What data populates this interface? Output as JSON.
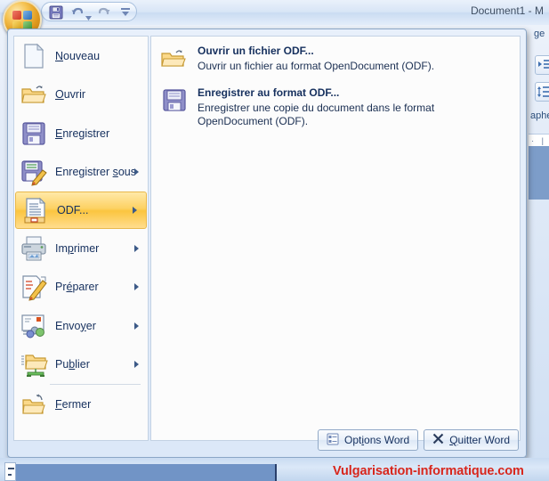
{
  "window": {
    "title": "Document1 - M",
    "office_button": "office-orb"
  },
  "quick_access_toolbar": {
    "buttons": [
      {
        "name": "save-icon",
        "label": "Enregistrer"
      },
      {
        "name": "undo-icon",
        "label": "Annuler"
      },
      {
        "name": "redo-icon",
        "label": "Rétablir"
      },
      {
        "name": "customize-icon",
        "label": "Personnaliser la barre d'outils Accès rapide"
      }
    ]
  },
  "ribbon_fragment": {
    "tab_label": "ge",
    "group_label": "aphe",
    "ruler_ticks": "· | ·"
  },
  "file_menu": {
    "items": [
      {
        "label_pre": "",
        "label_accel": "N",
        "label_post": "ouveau",
        "icon": "new-document-icon",
        "has_submenu": false,
        "selected": false
      },
      {
        "label_pre": "",
        "label_accel": "O",
        "label_post": "uvrir",
        "icon": "open-folder-icon",
        "has_submenu": false,
        "selected": false
      },
      {
        "label_pre": "",
        "label_accel": "E",
        "label_post": "nregistrer",
        "icon": "save-floppy-icon",
        "has_submenu": false,
        "selected": false
      },
      {
        "label_pre": "Enregistrer ",
        "label_accel": "s",
        "label_post": "ous",
        "icon": "save-as-icon",
        "has_submenu": true,
        "selected": false
      },
      {
        "label_pre": "ODF...",
        "label_accel": "",
        "label_post": "",
        "icon": "odf-document-icon",
        "has_submenu": true,
        "selected": true
      },
      {
        "label_pre": "Im",
        "label_accel": "p",
        "label_post": "rimer",
        "icon": "printer-icon",
        "has_submenu": true,
        "selected": false
      },
      {
        "label_pre": "Pr",
        "label_accel": "é",
        "label_post": "parer",
        "icon": "prepare-icon",
        "has_submenu": true,
        "selected": false
      },
      {
        "label_pre": "Envo",
        "label_accel": "y",
        "label_post": "er",
        "icon": "send-icon",
        "has_submenu": true,
        "selected": false
      },
      {
        "label_pre": "Pu",
        "label_accel": "b",
        "label_post": "lier",
        "icon": "publish-icon",
        "has_submenu": true,
        "selected": false
      },
      {
        "label_pre": "",
        "label_accel": "F",
        "label_post": "ermer",
        "icon": "close-folder-icon",
        "has_submenu": false,
        "selected": false
      }
    ]
  },
  "odf_panel": {
    "entries": [
      {
        "icon": "open-folder-icon",
        "title": "Ouvrir un fichier ODF...",
        "description": "Ouvrir un fichier au format OpenDocument (ODF)."
      },
      {
        "icon": "save-floppy-icon",
        "title": "Enregistrer au format ODF...",
        "description": "Enregistrer une copie du document dans le format OpenDocument (ODF)."
      }
    ]
  },
  "footer": {
    "options_pre": "Opt",
    "options_accel": "i",
    "options_post": "ons Word",
    "quit_pre": "",
    "quit_accel": "Q",
    "quit_post": "uitter Word"
  },
  "watermark": {
    "text": "Vulgarisation-informatique.com",
    "color": "#d8261c"
  }
}
